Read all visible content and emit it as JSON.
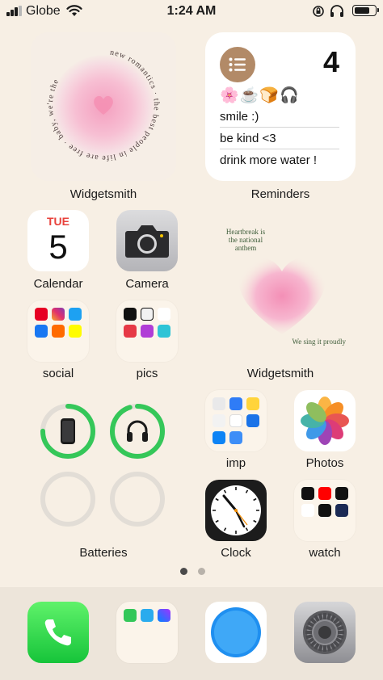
{
  "status_bar": {
    "carrier": "Globe",
    "time": "1:24 AM",
    "battery_level": 0.75
  },
  "widgetsmith_top": {
    "label": "Widgetsmith",
    "circle_text": "new romantics · the best people in life are free · baby, we're the"
  },
  "reminders": {
    "label": "Reminders",
    "count": "4",
    "emoji_row": "🌸☕🍞🎧",
    "items": [
      "smile :)",
      "be kind <3",
      "drink more water !"
    ]
  },
  "apps": {
    "calendar": {
      "label": "Calendar",
      "weekday": "TUE",
      "date": "5"
    },
    "camera": {
      "label": "Camera"
    },
    "social": {
      "label": "social"
    },
    "pics": {
      "label": "pics"
    },
    "imp": {
      "label": "imp"
    },
    "photos": {
      "label": "Photos"
    },
    "clock": {
      "label": "Clock"
    },
    "watch": {
      "label": "watch"
    }
  },
  "widgetsmith_mid": {
    "label": "Widgetsmith",
    "top_text": "Heartbreak is the national anthem",
    "bottom_text": "We sing it proudly"
  },
  "batteries": {
    "label": "Batteries",
    "devices": [
      {
        "icon": "iphone-icon",
        "level": 0.75
      },
      {
        "icon": "headphones-icon",
        "level": 0.95
      },
      {
        "icon": "empty-slot",
        "level": 0
      },
      {
        "icon": "empty-slot",
        "level": 0
      }
    ]
  },
  "page_dots": {
    "count": 2,
    "active": 0
  },
  "dock": [
    "phone-icon",
    "messages-folder-icon",
    "safari-icon",
    "settings-icon"
  ],
  "colors": {
    "background": "#f7efe4",
    "battery_green": "#35c759",
    "accent_pink": "#f49fbf",
    "reminders_brown": "#b28a67"
  }
}
